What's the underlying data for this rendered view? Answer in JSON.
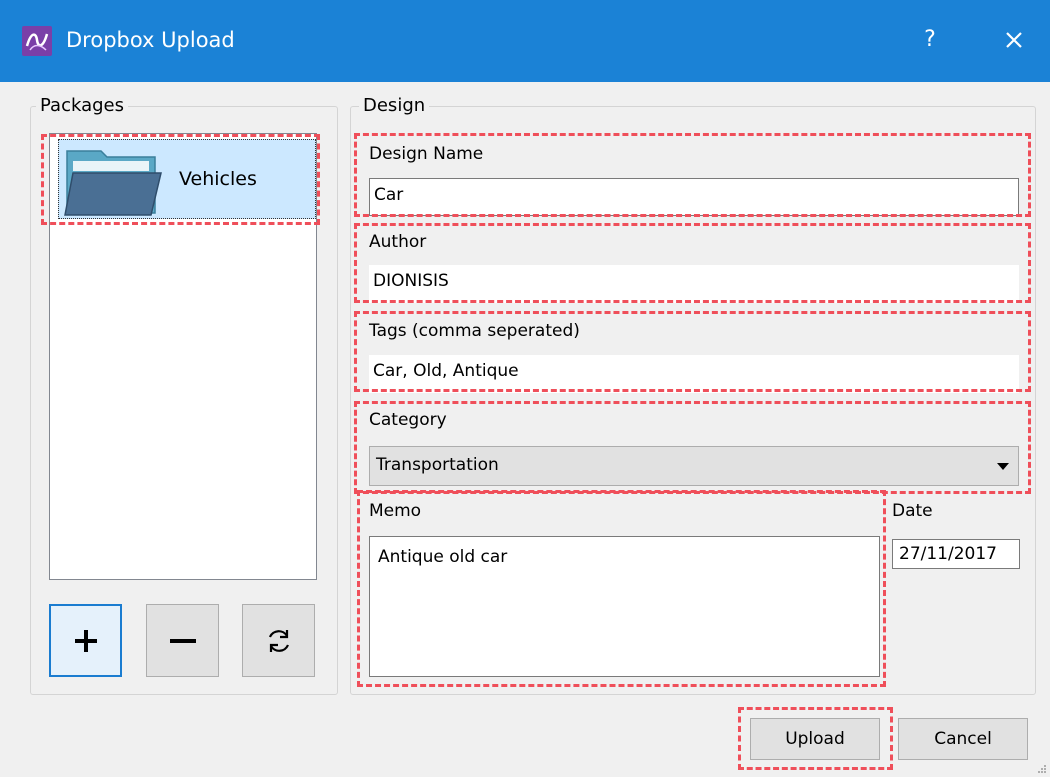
{
  "window": {
    "title": "Dropbox Upload",
    "help_label": "?"
  },
  "packages": {
    "group_label": "Packages",
    "items": [
      {
        "label": "Vehicles",
        "icon": "folder-icon",
        "selected": true
      }
    ],
    "buttons": [
      {
        "name": "add-package-button",
        "icon": "plus-icon"
      },
      {
        "name": "remove-package-button",
        "icon": "minus-icon"
      },
      {
        "name": "refresh-packages-button",
        "icon": "refresh-icon"
      }
    ]
  },
  "design": {
    "group_label": "Design",
    "design_name": {
      "label": "Design Name",
      "value": "Car"
    },
    "author": {
      "label": "Author",
      "value": "DIONISIS"
    },
    "tags": {
      "label": "Tags (comma seperated)",
      "value": "Car, Old, Antique"
    },
    "category": {
      "label": "Category",
      "value": "Transportation"
    },
    "memo": {
      "label": "Memo",
      "value": "Antique old car"
    },
    "date": {
      "label": "Date",
      "value": "27/11/2017"
    }
  },
  "actions": {
    "upload_label": "Upload",
    "cancel_label": "Cancel"
  },
  "colors": {
    "titlebar": "#1b82d6",
    "highlight": "#ef4f5a",
    "selection": "#cce8ff",
    "active_button_border": "#1a7cd0"
  }
}
